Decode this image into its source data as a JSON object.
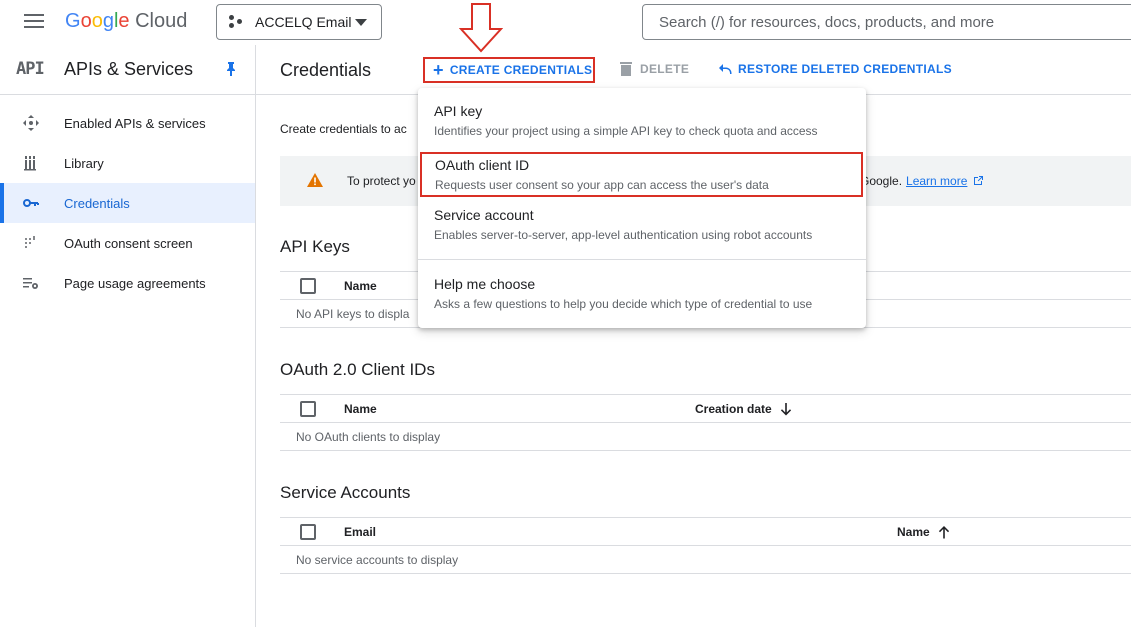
{
  "header": {
    "logo_google": "Google",
    "logo_cloud": "Cloud",
    "project_name": "ACCELQ Email",
    "search_placeholder": "Search (/) for resources, docs, products, and more"
  },
  "sidebar": {
    "logo_text": "API",
    "title": "APIs & Services",
    "items": [
      {
        "label": "Enabled APIs & services",
        "icon": "diamond-arrows-icon",
        "active": false
      },
      {
        "label": "Library",
        "icon": "library-icon",
        "active": false
      },
      {
        "label": "Credentials",
        "icon": "key-icon",
        "active": true
      },
      {
        "label": "OAuth consent screen",
        "icon": "dots-grid-icon",
        "active": false
      },
      {
        "label": "Page usage agreements",
        "icon": "settings-list-icon",
        "active": false
      }
    ]
  },
  "page": {
    "title": "Credentials",
    "create_label": "CREATE CREDENTIALS",
    "delete_label": "DELETE",
    "restore_label": "RESTORE DELETED CREDENTIALS",
    "intro": "Create credentials to ac",
    "warning_text": "To protect yo",
    "warning_tail": "Google.",
    "learn_more": "Learn more"
  },
  "menu": {
    "items": [
      {
        "title": "API key",
        "desc": "Identifies your project using a simple API key to check quota and access"
      },
      {
        "title": "OAuth client ID",
        "desc": "Requests user consent so your app can access the user's data"
      },
      {
        "title": "Service account",
        "desc": "Enables server-to-server, app-level authentication using robot accounts"
      },
      {
        "title": "Help me choose",
        "desc": "Asks a few questions to help you decide which type of credential to use"
      }
    ]
  },
  "sections": {
    "api_keys": {
      "title": "API Keys",
      "col_name": "Name",
      "empty": "No API keys to displa"
    },
    "oauth": {
      "title": "OAuth 2.0 Client IDs",
      "col_name": "Name",
      "col_created": "Creation date",
      "empty": "No OAuth clients to display"
    },
    "service": {
      "title": "Service Accounts",
      "col_email": "Email",
      "col_name": "Name",
      "empty": "No service accounts to display"
    }
  },
  "colors": {
    "accent": "#1a73e8",
    "highlight_red": "#d93025",
    "warning": "#e37400"
  }
}
